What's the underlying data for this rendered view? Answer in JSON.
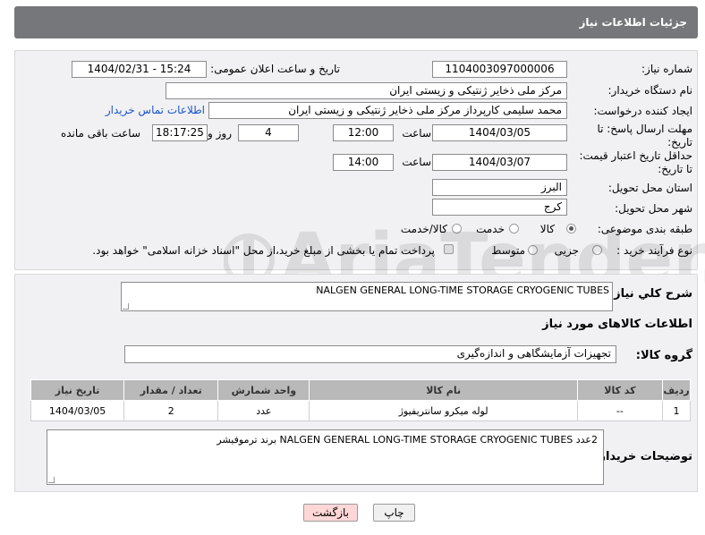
{
  "header": {
    "title": "جزئیات اطلاعات نیاز"
  },
  "form": {
    "need_number_label": "شماره نیاز:",
    "need_number": "1104003097000006",
    "announce_label": "تاریخ و ساعت اعلان عمومی:",
    "announce_value": "1404/02/31 - 15:24",
    "buyer_org_label": "نام دستگاه خریدار:",
    "buyer_org": "مرکز ملی ذخایر ژنتیکی و زیستی ایران",
    "creator_label": "ایجاد کننده درخواست:",
    "creator": "محمد سلیمی کارپرداز مرکز ملی ذخایر ژنتیکی و زیستی ایران",
    "contact_link": "اطلاعات تماس خریدار",
    "deadline_label_1": "مهلت ارسال پاسخ: تا",
    "deadline_label_2": "تاریخ:",
    "deadline_date": "1404/03/05",
    "time_label": "ساعت",
    "deadline_time": "12:00",
    "days_value": "4",
    "days_label": "روز و",
    "remaining_time": "18:17:25",
    "remaining_label": "ساعت باقی مانده",
    "price_label_1": "حداقل تاریخ اعتبار قیمت:",
    "price_label_2": "تا تاریخ:",
    "price_date": "1404/03/07",
    "price_time": "14:00",
    "province_label": "استان محل تحویل:",
    "province": "البرز",
    "city_label": "شهر محل تحویل:",
    "city": "کرج",
    "category_label": "طبقه بندی موضوعی:",
    "category_options": [
      "کالا",
      "خدمت",
      "کالا/خدمت"
    ],
    "category_selected": "کالا",
    "process_label": "نوع فرآیند خرید :",
    "process_options": [
      "جزیی",
      "متوسط"
    ],
    "process_selected": "جزیی",
    "payment_note": "پرداخت تمام یا بخشی از مبلغ خرید،از محل \"اسناد خزانه اسلامی\" خواهد بود."
  },
  "details": {
    "general_desc_label": "شرح كلي نياز:",
    "general_desc": "NALGEN GENERAL LONG-TIME STORAGE CRYOGENIC TUBES",
    "goods_info_title": "اطلاعات کالاهای مورد نیاز",
    "goods_group_label": "گروه کالا:",
    "goods_group": "تجهیزات آزمایشگاهی و اندازه‌گیری",
    "table": {
      "headers": [
        "ردیف",
        "کد کالا",
        "نام کالا",
        "واحد شمارش",
        "تعداد / مقدار",
        "تاریخ نیاز"
      ],
      "rows": [
        [
          "1",
          "--",
          "لوله میکرو سانتریفیوژ",
          "عدد",
          "2",
          "1404/03/05"
        ]
      ]
    },
    "buyer_notes_label": "توضیحات خریدار:",
    "buyer_notes": "2عدد NALGEN GENERAL LONG-TIME STORAGE CRYOGENIC TUBES برند ترموفیشر"
  },
  "buttons": {
    "print": "چاپ",
    "back": "بازگشت"
  },
  "watermark": "AriaTender.net"
}
